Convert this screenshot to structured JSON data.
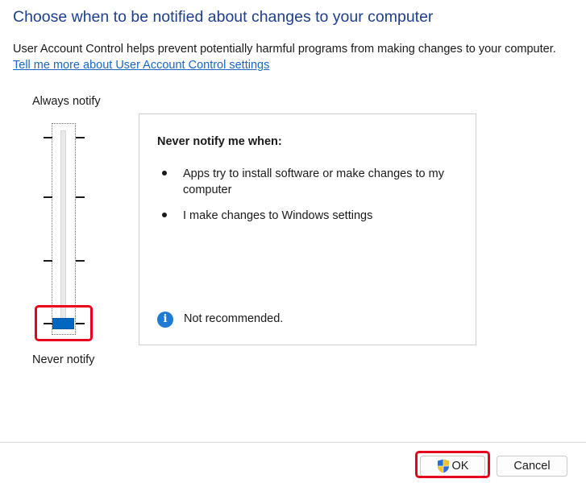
{
  "header": {
    "title": "Choose when to be notified about changes to your computer",
    "description": "User Account Control helps prevent potentially harmful programs from making changes to your computer.",
    "link": "Tell me more about User Account Control settings"
  },
  "slider": {
    "top_label": "Always notify",
    "bottom_label": "Never notify",
    "levels": 4,
    "selected_level": 1,
    "accent": "#0067c0"
  },
  "panel": {
    "heading": "Never notify me when:",
    "bullets": [
      "Apps try to install software or make changes to my computer",
      "I make changes to Windows settings"
    ],
    "note": "Not recommended.",
    "note_icon": "info-icon"
  },
  "footer": {
    "ok_label": "OK",
    "cancel_label": "Cancel",
    "ok_icon": "shield-icon"
  },
  "highlight_color": "#e8001c"
}
